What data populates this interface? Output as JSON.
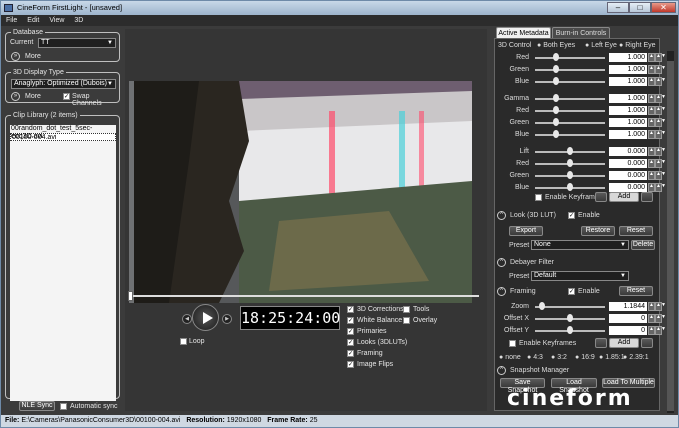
{
  "window": {
    "title": "CineForm FirstLight - [unsaved]"
  },
  "menu": [
    "File",
    "Edit",
    "View",
    "3D"
  ],
  "database": {
    "title": "Database",
    "current_label": "Current",
    "current_value": "TT",
    "more_label": "More"
  },
  "display": {
    "title": "3D Display Type",
    "value": "Anaglyph: Optimized (Dubois)",
    "more_label": "More",
    "swap_label": "Swap Channels"
  },
  "library": {
    "title": "Clip Library (2 items)",
    "items": [
      "00random_dot_test_5sec-eoq3D.avi",
      "00100-004.avi"
    ]
  },
  "bottom_left": {
    "nle_sync": "NLE Sync",
    "auto_sync": "Automatic sync"
  },
  "player": {
    "timecode": "18:25:24:00",
    "loop": "Loop"
  },
  "options": {
    "left": [
      "3D Corrections",
      "White  Balance",
      "Primaries",
      "Looks (3DLUTs)",
      "Framing",
      "Image Flips"
    ],
    "right": [
      "Tools",
      "Overlay"
    ]
  },
  "tabs": [
    "Active Metadata",
    "Burn-in Controls"
  ],
  "control3d": {
    "label": "3D Control",
    "options": [
      "Both Eyes",
      "Left Eye",
      "Right Eye"
    ]
  },
  "gain": {
    "rows": [
      {
        "name": "Red",
        "value": "1.000",
        "pos": 0.3
      },
      {
        "name": "Green",
        "value": "1.000",
        "pos": 0.3
      },
      {
        "name": "Blue",
        "value": "1.000",
        "pos": 0.3
      }
    ]
  },
  "gamma": {
    "rows": [
      {
        "name": "Gamma",
        "value": "1.000",
        "pos": 0.3
      },
      {
        "name": "Red",
        "value": "1.000",
        "pos": 0.3
      },
      {
        "name": "Green",
        "value": "1.000",
        "pos": 0.3
      },
      {
        "name": "Blue",
        "value": "1.000",
        "pos": 0.3
      }
    ]
  },
  "lift": {
    "rows": [
      {
        "name": "Lift",
        "value": "0.000",
        "pos": 0.5
      },
      {
        "name": "Red",
        "value": "0.000",
        "pos": 0.5
      },
      {
        "name": "Green",
        "value": "0.000",
        "pos": 0.5
      },
      {
        "name": "Blue",
        "value": "0.000",
        "pos": 0.5
      }
    ]
  },
  "keyframes": {
    "label": "Enable Keyframes",
    "add": "Add"
  },
  "look": {
    "title": "Look (3D LUT)",
    "enable": "Enable",
    "export": "Export",
    "restore": "Restore",
    "reset": "Reset",
    "preset_label": "Preset",
    "preset_value": "None",
    "delete": "Delete"
  },
  "debayer": {
    "title": "Debayer Filter",
    "preset_label": "Preset",
    "preset_value": "Default"
  },
  "framing": {
    "title": "Framing",
    "enable": "Enable",
    "reset": "Reset",
    "rows": [
      {
        "name": "Zoom",
        "value": "1.1844",
        "pos": 0.1
      },
      {
        "name": "Offset X",
        "value": "0",
        "pos": 0.5
      },
      {
        "name": "Offset Y",
        "value": "0",
        "pos": 0.5
      }
    ],
    "keyframes": "Enable Keyframes",
    "add": "Add",
    "aspects": [
      "none",
      "4:3",
      "3:2",
      "16:9",
      "1.85:1",
      "2.39:1"
    ]
  },
  "snapshot": {
    "title": "Snapshot Manager",
    "save": "Save Snapshot",
    "load": "Load Snapshot",
    "load_multi": "Load To Multiple"
  },
  "logo": "cineform",
  "status": {
    "file_label": "File:",
    "file": "E:\\Cameras\\PanasonicConsumer3D\\00100-004.avi",
    "res_label": "Resolution:",
    "res": "1920x1080",
    "fr_label": "Frame Rate:",
    "fr": "25"
  }
}
